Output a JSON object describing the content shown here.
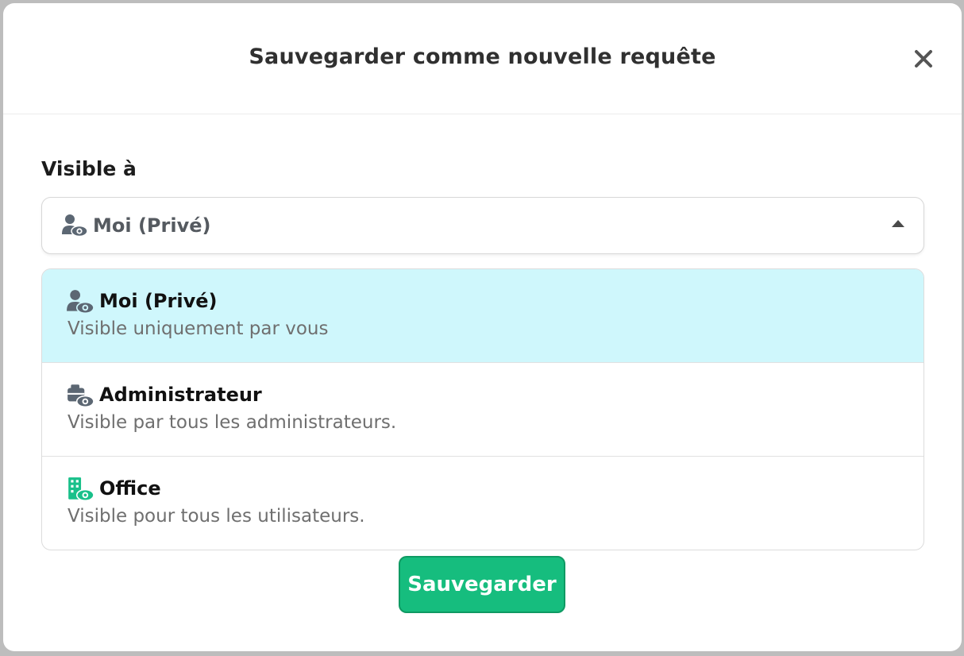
{
  "modal": {
    "title": "Sauvegarder comme nouvelle requête",
    "close_icon": "close-icon"
  },
  "visibility": {
    "label": "Visible à",
    "selected_value": "Moi (Privé)",
    "selected_icon": "user-eye-icon",
    "options": [
      {
        "title": "Moi (Privé)",
        "description": "Visible uniquement par vous",
        "icon": "user-eye-icon",
        "selected": true
      },
      {
        "title": "Administrateur",
        "description": "Visible par tous les administrateurs.",
        "icon": "admin-eye-icon",
        "selected": false
      },
      {
        "title": "Office",
        "description": "Visible pour tous les utilisateurs.",
        "icon": "building-eye-icon",
        "selected": false
      }
    ]
  },
  "actions": {
    "save_label": "Sauvegarder"
  },
  "colors": {
    "selected_background": "#cff7fc",
    "save_button": "#16bd7e",
    "icon_gray": "#5c6773",
    "icon_green": "#19c08a"
  }
}
